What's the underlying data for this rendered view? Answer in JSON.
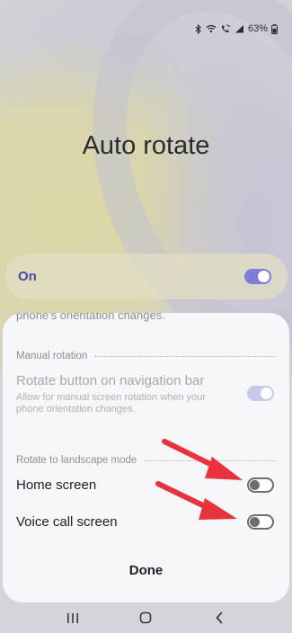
{
  "status_bar": {
    "battery_percent": "63%",
    "icons": [
      "bluetooth-icon",
      "wifi-icon",
      "wifi-calling-icon",
      "signal-icon",
      "battery-icon"
    ]
  },
  "page": {
    "title": "Auto rotate"
  },
  "master_switch": {
    "label": "On",
    "checked": true
  },
  "sheet": {
    "cut_off_text": "phone's orientation changes.",
    "manual_rotation": {
      "section_title": "Manual rotation",
      "item_title": "Rotate button on navigation bar",
      "item_subtitle": "Allow for manual screen rotation when your phone orientation changes.",
      "checked": true,
      "enabled": false
    },
    "landscape": {
      "section_title": "Rotate to landscape mode",
      "items": [
        {
          "title": "Home screen",
          "checked": false
        },
        {
          "title": "Voice call screen",
          "checked": false
        }
      ]
    },
    "done_label": "Done"
  },
  "annotations": {
    "arrow_color": "#e8323c"
  },
  "colors": {
    "accent": "#7b7fd8",
    "switch_label": "#4a4aa8",
    "sheet_bg": "#f7f6fa"
  },
  "nav_bar": {
    "buttons": [
      "recents-icon",
      "home-icon",
      "back-icon"
    ]
  }
}
